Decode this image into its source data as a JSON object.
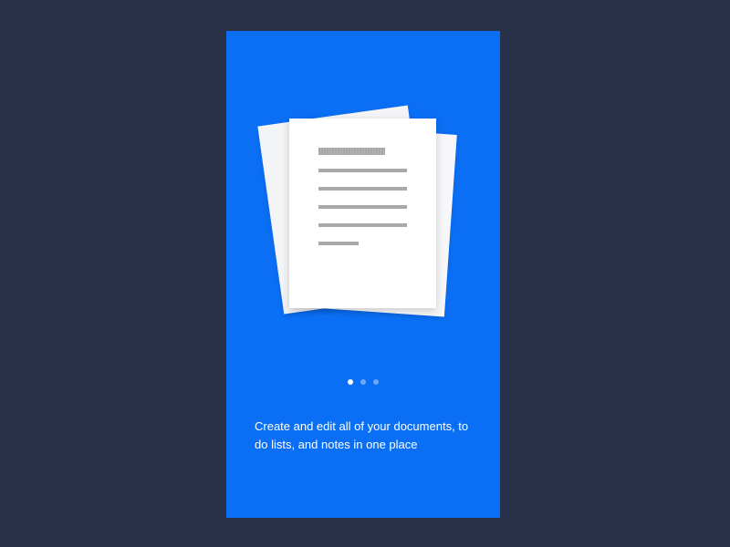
{
  "onboarding": {
    "caption": "Create and edit all of your documents, to do lists, and notes in one place",
    "illustration_icon": "documents-stack-icon",
    "pagination": {
      "total": 3,
      "active_index": 0
    }
  },
  "colors": {
    "page_background": "#283149",
    "screen_background": "#0b6ff5",
    "paper": "#ffffff",
    "text_lines": "#a9a9a9"
  }
}
